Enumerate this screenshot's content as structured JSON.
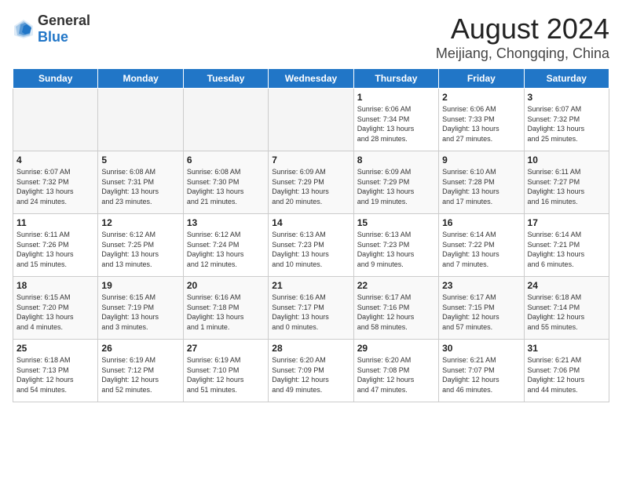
{
  "logo": {
    "text_general": "General",
    "text_blue": "Blue"
  },
  "calendar": {
    "title": "August 2024",
    "subtitle": "Meijiang, Chongqing, China",
    "days_of_week": [
      "Sunday",
      "Monday",
      "Tuesday",
      "Wednesday",
      "Thursday",
      "Friday",
      "Saturday"
    ],
    "weeks": [
      [
        {
          "day": "",
          "info": ""
        },
        {
          "day": "",
          "info": ""
        },
        {
          "day": "",
          "info": ""
        },
        {
          "day": "",
          "info": ""
        },
        {
          "day": "1",
          "info": "Sunrise: 6:06 AM\nSunset: 7:34 PM\nDaylight: 13 hours\nand 28 minutes."
        },
        {
          "day": "2",
          "info": "Sunrise: 6:06 AM\nSunset: 7:33 PM\nDaylight: 13 hours\nand 27 minutes."
        },
        {
          "day": "3",
          "info": "Sunrise: 6:07 AM\nSunset: 7:32 PM\nDaylight: 13 hours\nand 25 minutes."
        }
      ],
      [
        {
          "day": "4",
          "info": "Sunrise: 6:07 AM\nSunset: 7:32 PM\nDaylight: 13 hours\nand 24 minutes."
        },
        {
          "day": "5",
          "info": "Sunrise: 6:08 AM\nSunset: 7:31 PM\nDaylight: 13 hours\nand 23 minutes."
        },
        {
          "day": "6",
          "info": "Sunrise: 6:08 AM\nSunset: 7:30 PM\nDaylight: 13 hours\nand 21 minutes."
        },
        {
          "day": "7",
          "info": "Sunrise: 6:09 AM\nSunset: 7:29 PM\nDaylight: 13 hours\nand 20 minutes."
        },
        {
          "day": "8",
          "info": "Sunrise: 6:09 AM\nSunset: 7:29 PM\nDaylight: 13 hours\nand 19 minutes."
        },
        {
          "day": "9",
          "info": "Sunrise: 6:10 AM\nSunset: 7:28 PM\nDaylight: 13 hours\nand 17 minutes."
        },
        {
          "day": "10",
          "info": "Sunrise: 6:11 AM\nSunset: 7:27 PM\nDaylight: 13 hours\nand 16 minutes."
        }
      ],
      [
        {
          "day": "11",
          "info": "Sunrise: 6:11 AM\nSunset: 7:26 PM\nDaylight: 13 hours\nand 15 minutes."
        },
        {
          "day": "12",
          "info": "Sunrise: 6:12 AM\nSunset: 7:25 PM\nDaylight: 13 hours\nand 13 minutes."
        },
        {
          "day": "13",
          "info": "Sunrise: 6:12 AM\nSunset: 7:24 PM\nDaylight: 13 hours\nand 12 minutes."
        },
        {
          "day": "14",
          "info": "Sunrise: 6:13 AM\nSunset: 7:23 PM\nDaylight: 13 hours\nand 10 minutes."
        },
        {
          "day": "15",
          "info": "Sunrise: 6:13 AM\nSunset: 7:23 PM\nDaylight: 13 hours\nand 9 minutes."
        },
        {
          "day": "16",
          "info": "Sunrise: 6:14 AM\nSunset: 7:22 PM\nDaylight: 13 hours\nand 7 minutes."
        },
        {
          "day": "17",
          "info": "Sunrise: 6:14 AM\nSunset: 7:21 PM\nDaylight: 13 hours\nand 6 minutes."
        }
      ],
      [
        {
          "day": "18",
          "info": "Sunrise: 6:15 AM\nSunset: 7:20 PM\nDaylight: 13 hours\nand 4 minutes."
        },
        {
          "day": "19",
          "info": "Sunrise: 6:15 AM\nSunset: 7:19 PM\nDaylight: 13 hours\nand 3 minutes."
        },
        {
          "day": "20",
          "info": "Sunrise: 6:16 AM\nSunset: 7:18 PM\nDaylight: 13 hours\nand 1 minute."
        },
        {
          "day": "21",
          "info": "Sunrise: 6:16 AM\nSunset: 7:17 PM\nDaylight: 13 hours\nand 0 minutes."
        },
        {
          "day": "22",
          "info": "Sunrise: 6:17 AM\nSunset: 7:16 PM\nDaylight: 12 hours\nand 58 minutes."
        },
        {
          "day": "23",
          "info": "Sunrise: 6:17 AM\nSunset: 7:15 PM\nDaylight: 12 hours\nand 57 minutes."
        },
        {
          "day": "24",
          "info": "Sunrise: 6:18 AM\nSunset: 7:14 PM\nDaylight: 12 hours\nand 55 minutes."
        }
      ],
      [
        {
          "day": "25",
          "info": "Sunrise: 6:18 AM\nSunset: 7:13 PM\nDaylight: 12 hours\nand 54 minutes."
        },
        {
          "day": "26",
          "info": "Sunrise: 6:19 AM\nSunset: 7:12 PM\nDaylight: 12 hours\nand 52 minutes."
        },
        {
          "day": "27",
          "info": "Sunrise: 6:19 AM\nSunset: 7:10 PM\nDaylight: 12 hours\nand 51 minutes."
        },
        {
          "day": "28",
          "info": "Sunrise: 6:20 AM\nSunset: 7:09 PM\nDaylight: 12 hours\nand 49 minutes."
        },
        {
          "day": "29",
          "info": "Sunrise: 6:20 AM\nSunset: 7:08 PM\nDaylight: 12 hours\nand 47 minutes."
        },
        {
          "day": "30",
          "info": "Sunrise: 6:21 AM\nSunset: 7:07 PM\nDaylight: 12 hours\nand 46 minutes."
        },
        {
          "day": "31",
          "info": "Sunrise: 6:21 AM\nSunset: 7:06 PM\nDaylight: 12 hours\nand 44 minutes."
        }
      ]
    ]
  }
}
